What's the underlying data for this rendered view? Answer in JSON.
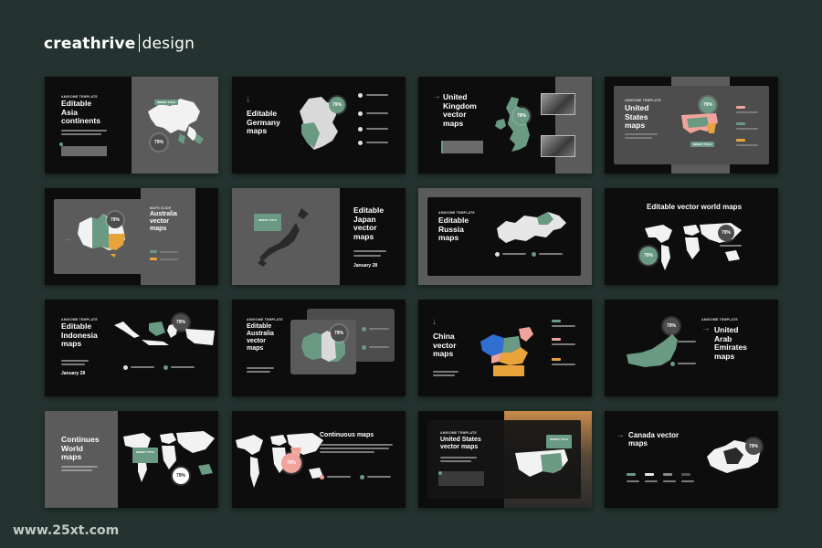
{
  "brand": {
    "name_bold": "creathrive",
    "name_light": "design"
  },
  "watermark": "www.25xt.com",
  "colors": {
    "background": "#243330",
    "slide": "#0d0d0d",
    "accent_green": "#6a9a83",
    "accent_orange": "#e8a43a",
    "accent_pink": "#f0a39b",
    "panel_gray": "#5b5b5b"
  },
  "common": {
    "kicker": "AMIGOME TEMPLATE",
    "insert_title": "INSERT TITLE",
    "percent": "79%",
    "date": "January 28",
    "kicker_alt": "MAPS SLIDE"
  },
  "slides": [
    {
      "title": "Editable\nAsia\ncontinents"
    },
    {
      "title": "Editable\nGermany\nmaps"
    },
    {
      "title": "United\nKingdom\nvector\nmaps"
    },
    {
      "title": "United\nStates\nmaps"
    },
    {
      "title": "Australia\nvector\nmaps"
    },
    {
      "title": "Editable\nJapan\nvector\nmaps"
    },
    {
      "title": "Editable\nRussia\nmaps"
    },
    {
      "title": "Editable vector world maps"
    },
    {
      "title": "Editable\nIndonesia\nmaps"
    },
    {
      "title": "Editable\nAustralia\nvector\nmaps"
    },
    {
      "title": "China\nvector\nmaps"
    },
    {
      "title": "United\nArab\nEmirates\nmaps"
    },
    {
      "title": "Continues\nWorld\nmaps"
    },
    {
      "title": "Continuous maps"
    },
    {
      "title": "United States\nvector maps"
    },
    {
      "title": "Canada vector\nmaps"
    }
  ]
}
